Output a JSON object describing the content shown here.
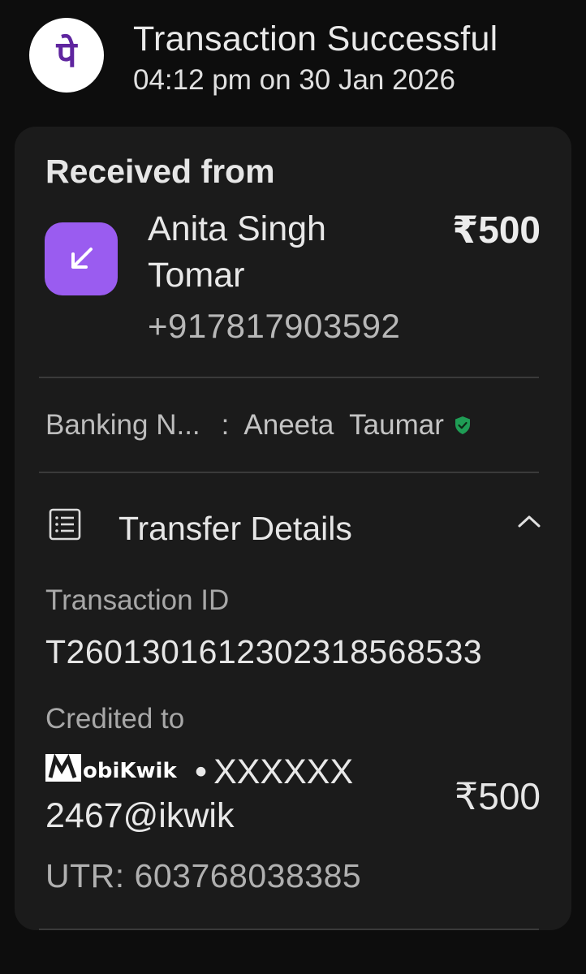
{
  "header": {
    "logo_glyph": "पे",
    "title": "Transaction Successful",
    "time": "04:12 pm on 30 Jan 2026"
  },
  "sender": {
    "section_label": "Received from",
    "name": "Anita Singh Tomar",
    "amount": "₹500",
    "phone": "+917817903592",
    "icon": "arrow-down-left-icon"
  },
  "banking": {
    "label": "Banking N...",
    "separator": ":",
    "name": "Aneeta  Taumar",
    "verified_icon": "verified-shield-icon"
  },
  "transfer": {
    "title": "Transfer Details",
    "expand_icon": "chevron-up-icon",
    "transaction_id_label": "Transaction ID",
    "transaction_id": "T2601301612302318568533",
    "credited_label": "Credited to",
    "wallet_brand": "MobiKwik",
    "bullet": "•",
    "account_part1": "XXXXXX",
    "account_part2": "2467@ikwik",
    "credited_amount": "₹500",
    "utr": "UTR: 603768038385"
  },
  "colors": {
    "background": "#0d0d0d",
    "card": "#1b1b1b",
    "brand_purple": "#5f259f",
    "arrow_tile": "#9a5cf0",
    "verified_green": "#1f9d55"
  }
}
